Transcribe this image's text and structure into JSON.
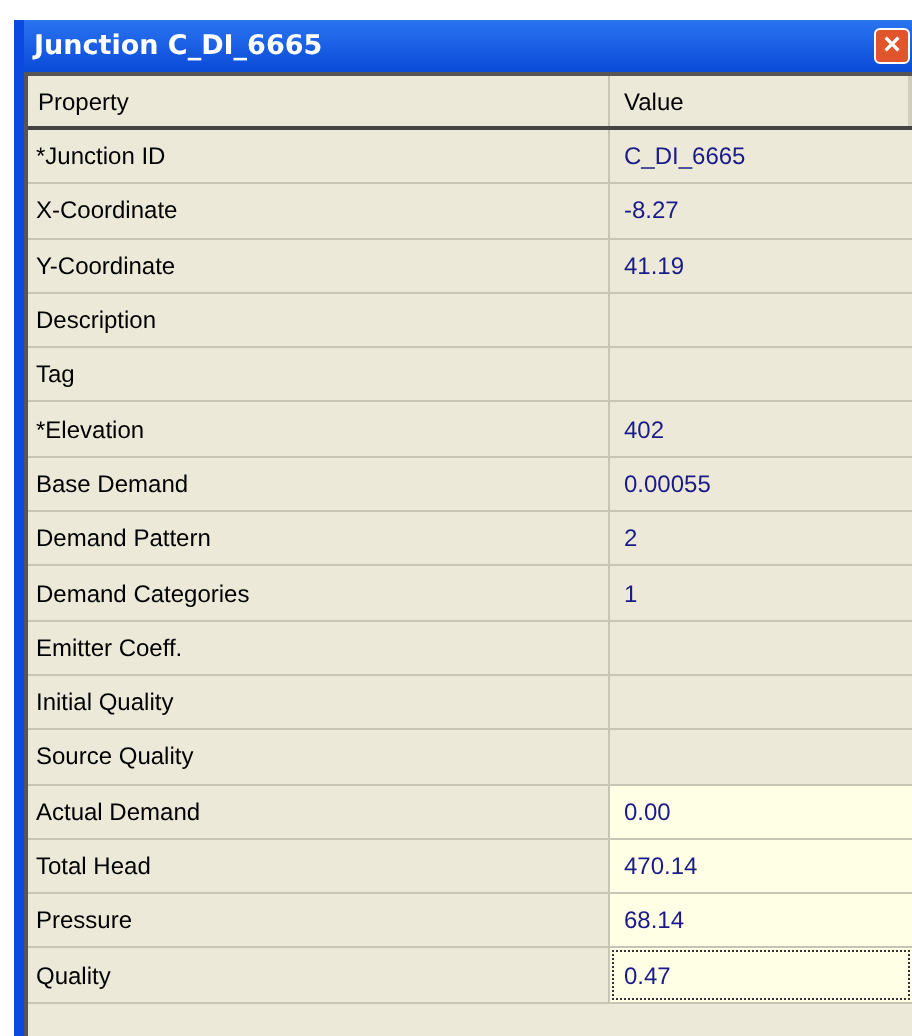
{
  "window": {
    "title": "Junction C_DI_6665",
    "close": "×"
  },
  "table": {
    "columns": [
      "Property",
      "Value"
    ],
    "rows": [
      {
        "property": "*Junction ID",
        "value": "C_DI_6665",
        "kind": "input",
        "selected": false
      },
      {
        "property": "X-Coordinate",
        "value": "-8.27",
        "kind": "input",
        "selected": false
      },
      {
        "property": "Y-Coordinate",
        "value": "41.19",
        "kind": "input",
        "selected": false
      },
      {
        "property": "Description",
        "kind": "input",
        "selected": false
      },
      {
        "property": "Tag",
        "kind": "input",
        "selected": false
      },
      {
        "property": "*Elevation",
        "value": "402",
        "kind": "input",
        "selected": false
      },
      {
        "property": "Base Demand",
        "value": "0.00055",
        "kind": "input",
        "selected": false
      },
      {
        "property": "Demand Pattern",
        "value": "2",
        "kind": "input",
        "selected": false
      },
      {
        "property": "Demand Categories",
        "value": "1",
        "kind": "input",
        "selected": false
      },
      {
        "property": "Emitter Coeff.",
        "kind": "input",
        "selected": false
      },
      {
        "property": "Initial Quality",
        "kind": "input",
        "selected": false
      },
      {
        "property": "Source Quality",
        "kind": "input",
        "selected": false
      },
      {
        "property": "Actual Demand",
        "value": "0.00",
        "kind": "result",
        "selected": false
      },
      {
        "property": "Total Head",
        "value": "470.14",
        "kind": "result",
        "selected": false
      },
      {
        "property": "Pressure",
        "value": "68.14",
        "kind": "result",
        "selected": false
      },
      {
        "property": "Quality",
        "value": "0.47",
        "kind": "result",
        "selected": true
      }
    ]
  }
}
